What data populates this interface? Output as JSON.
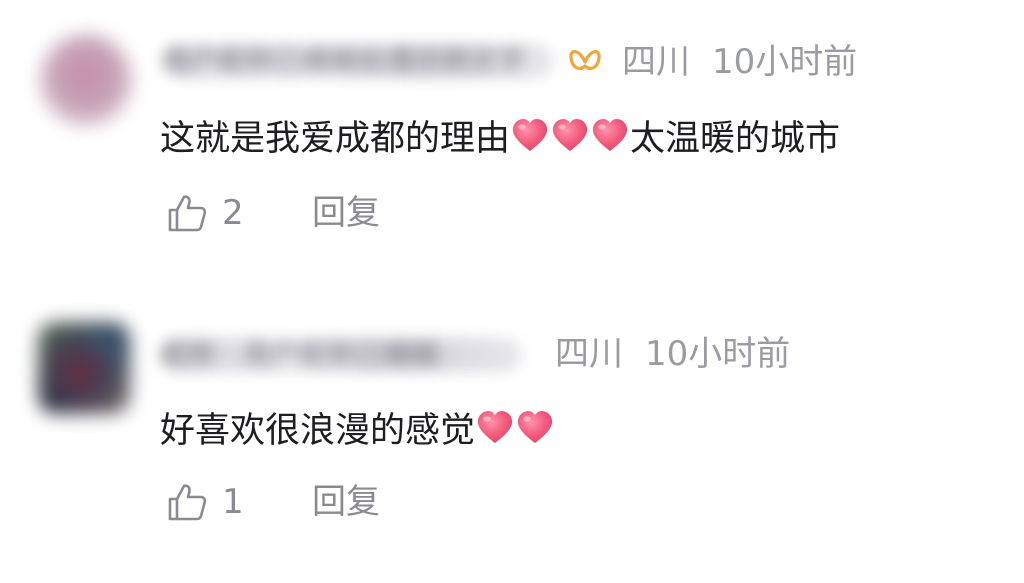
{
  "comments": [
    {
      "username": "用户昵称已模糊处理示例文字",
      "location": "四川",
      "time": "10小时前",
      "text_before": "这就是我爱成都的理由",
      "text_after": "太温暖的城市",
      "likes": "2",
      "reply_label": "回复"
    },
    {
      "username": "昵称 · 用户昵称已模糊",
      "location": "四川",
      "time": "10小时前",
      "text_before": "好喜欢很浪漫的感觉",
      "text_after": "",
      "likes": "1",
      "reply_label": "回复"
    }
  ],
  "colors": {
    "meta": "#9b9ba2",
    "text": "#1e1e22",
    "heart": "#f25a7c",
    "badge": "#f3a43a"
  },
  "icons": {
    "badge": "butterfly-icon",
    "heart": "heart-icon",
    "like": "thumbs-up-icon"
  }
}
